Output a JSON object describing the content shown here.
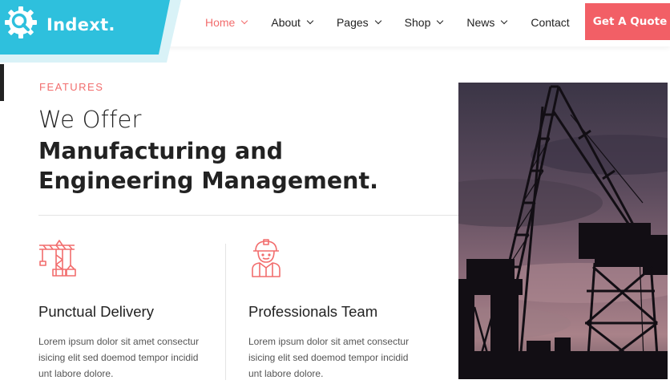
{
  "brand": {
    "name": "Indext.",
    "accent": "#2ec0dd",
    "accent_light": "#d9f2f7",
    "primary": "#f26d6d",
    "icon": "gear-search-icon"
  },
  "nav": {
    "items": [
      {
        "label": "Home",
        "active": true,
        "dropdown": true
      },
      {
        "label": "About",
        "dropdown": true
      },
      {
        "label": "Pages",
        "dropdown": true
      },
      {
        "label": "Shop",
        "dropdown": true
      },
      {
        "label": "News",
        "dropdown": true
      },
      {
        "label": "Contact",
        "dropdown": false
      }
    ],
    "cta": "Get A Quote"
  },
  "section": {
    "eyebrow": "FEATURES",
    "title_light": "We Offer",
    "title_bold_line1": "Manufacturing and",
    "title_bold_line2": "Engineering Management."
  },
  "features": [
    {
      "icon": "crane-icon",
      "title": "Punctual Delivery",
      "text": "Lorem ipsum dolor sit amet consectur isicing elit sed doemod tempor incidid unt labore dolore."
    },
    {
      "icon": "worker-helmet-icon",
      "title": "Professionals Team",
      "text": "Lorem ipsum dolor sit amet consectur isicing elit sed doemod tempor incidid unt labore dolore."
    }
  ],
  "image": {
    "subject": "crane-silhouette-photo"
  }
}
